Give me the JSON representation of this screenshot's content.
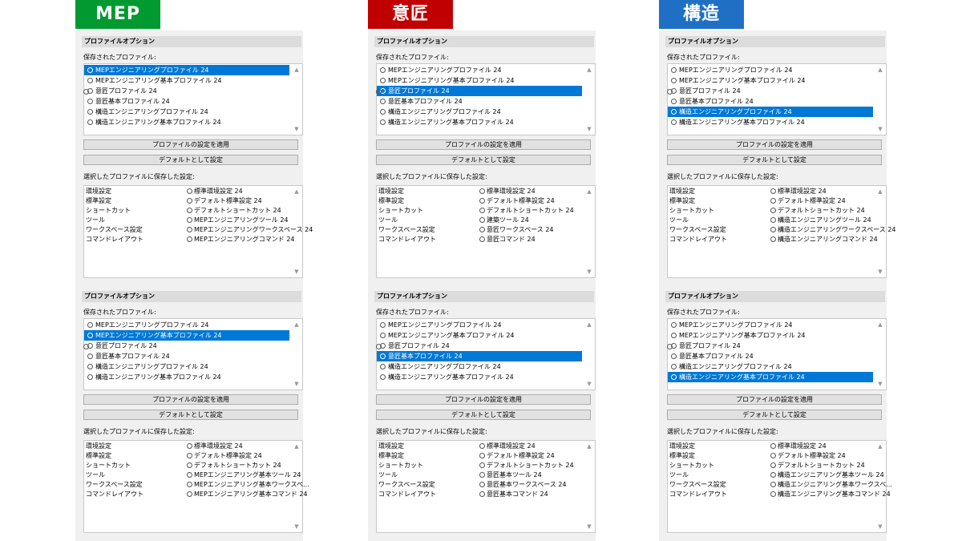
{
  "columns": [
    {
      "title": "MEP",
      "color": "#009a30",
      "panels": [
        {
          "header": "プロファイルオプション",
          "saved_label": "保存されたプロファイル:",
          "profiles": [
            {
              "name": "MEPエンジニアリングプロファイル 24",
              "selected": true,
              "icon": "profile-icon"
            },
            {
              "name": "MEPエンジニアリング基本プロファイル 24",
              "selected": false,
              "icon": "profile-icon"
            },
            {
              "name": "意匠プロファイル 24",
              "selected": false,
              "icon": "active-profile-icon"
            },
            {
              "name": "意匠基本プロファイル 24",
              "selected": false,
              "icon": "profile-icon"
            },
            {
              "name": "構造エンジニアリングプロファイル 24",
              "selected": false,
              "icon": "profile-icon"
            },
            {
              "name": "構造エンジニアリング基本プロファイル 24",
              "selected": false,
              "icon": "profile-icon"
            }
          ],
          "apply_button": "プロファイルの設定を適用",
          "default_button": "デフォルトとして設定",
          "settings_label": "選択したプロファイルに保存した設定:",
          "settings": [
            {
              "name": "環境設定",
              "value": "標準環境設定 24"
            },
            {
              "name": "標準設定",
              "value": "デフォルト標準設定 24"
            },
            {
              "name": "ショートカット",
              "value": "デフォルトショートカット 24"
            },
            {
              "name": "ツール",
              "value": "MEPエンジニアリングツール 24"
            },
            {
              "name": "ワークスペース設定",
              "value": "MEPエンジニアリングワークスペース 24"
            },
            {
              "name": "コマンドレイアウト",
              "value": "MEPエンジニアリングコマンド 24"
            }
          ]
        },
        {
          "header": "プロファイルオプション",
          "saved_label": "保存されたプロファイル:",
          "profiles": [
            {
              "name": "MEPエンジニアリングプロファイル 24",
              "selected": false,
              "icon": "profile-icon"
            },
            {
              "name": "MEPエンジニアリング基本プロファイル 24",
              "selected": true,
              "icon": "profile-icon"
            },
            {
              "name": "意匠プロファイル 24",
              "selected": false,
              "icon": "active-profile-icon"
            },
            {
              "name": "意匠基本プロファイル 24",
              "selected": false,
              "icon": "profile-icon"
            },
            {
              "name": "構造エンジニアリングプロファイル 24",
              "selected": false,
              "icon": "profile-icon"
            },
            {
              "name": "構造エンジニアリング基本プロファイル 24",
              "selected": false,
              "icon": "profile-icon"
            }
          ],
          "apply_button": "プロファイルの設定を適用",
          "default_button": "デフォルトとして設定",
          "settings_label": "選択したプロファイルに保存した設定:",
          "settings": [
            {
              "name": "環境設定",
              "value": "標準環境設定 24"
            },
            {
              "name": "標準設定",
              "value": "デフォルト標準設定 24"
            },
            {
              "name": "ショートカット",
              "value": "デフォルトショートカット 24"
            },
            {
              "name": "ツール",
              "value": "MEPエンジニアリング基本ツール 24"
            },
            {
              "name": "ワークスペース設定",
              "value": "MEPエンジニアリング基本ワークスペ..."
            },
            {
              "name": "コマンドレイアウト",
              "value": "MEPエンジニアリング基本コマンド 24"
            }
          ]
        }
      ]
    },
    {
      "title": "意匠",
      "color": "#c00000",
      "panels": [
        {
          "header": "プロファイルオプション",
          "saved_label": "保存されたプロファイル:",
          "profiles": [
            {
              "name": "MEPエンジニアリングプロファイル 24",
              "selected": false,
              "icon": "profile-icon"
            },
            {
              "name": "MEPエンジニアリング基本プロファイル 24",
              "selected": false,
              "icon": "profile-icon"
            },
            {
              "name": "意匠プロファイル 24",
              "selected": true,
              "icon": "active-profile-icon"
            },
            {
              "name": "意匠基本プロファイル 24",
              "selected": false,
              "icon": "profile-icon"
            },
            {
              "name": "構造エンジニアリングプロファイル 24",
              "selected": false,
              "icon": "profile-icon"
            },
            {
              "name": "構造エンジニアリング基本プロファイル 24",
              "selected": false,
              "icon": "profile-icon"
            }
          ],
          "apply_button": "プロファイルの設定を適用",
          "default_button": "デフォルトとして設定",
          "settings_label": "選択したプロファイルに保存した設定:",
          "settings": [
            {
              "name": "環境設定",
              "value": "標準環境設定 24"
            },
            {
              "name": "標準設定",
              "value": "デフォルト標準設定 24"
            },
            {
              "name": "ショートカット",
              "value": "デフォルトショートカット 24"
            },
            {
              "name": "ツール",
              "value": "建築ツール 24"
            },
            {
              "name": "ワークスペース設定",
              "value": "意匠ワークスペース 24"
            },
            {
              "name": "コマンドレイアウト",
              "value": "意匠コマンド 24"
            }
          ]
        },
        {
          "header": "プロファイルオプション",
          "saved_label": "保存されたプロファイル:",
          "profiles": [
            {
              "name": "MEPエンジニアリングプロファイル 24",
              "selected": false,
              "icon": "profile-icon"
            },
            {
              "name": "MEPエンジニアリング基本プロファイル 24",
              "selected": false,
              "icon": "profile-icon"
            },
            {
              "name": "意匠プロファイル 24",
              "selected": false,
              "icon": "active-profile-icon"
            },
            {
              "name": "意匠基本プロファイル 24",
              "selected": true,
              "icon": "profile-icon"
            },
            {
              "name": "構造エンジニアリングプロファイル 24",
              "selected": false,
              "icon": "profile-icon"
            },
            {
              "name": "構造エンジニアリング基本プロファイル 24",
              "selected": false,
              "icon": "profile-icon"
            }
          ],
          "apply_button": "プロファイルの設定を適用",
          "default_button": "デフォルトとして設定",
          "settings_label": "選択したプロファイルに保存した設定:",
          "settings": [
            {
              "name": "環境設定",
              "value": "標準環境設定 24"
            },
            {
              "name": "標準設定",
              "value": "デフォルト標準設定 24"
            },
            {
              "name": "ショートカット",
              "value": "デフォルトショートカット 24"
            },
            {
              "name": "ツール",
              "value": "意匠基本ツール 24"
            },
            {
              "name": "ワークスペース設定",
              "value": "意匠基本ワークスペース 24"
            },
            {
              "name": "コマンドレイアウト",
              "value": "意匠基本コマンド 24"
            }
          ]
        }
      ]
    },
    {
      "title": "構造",
      "color": "#1f6fc5",
      "panels": [
        {
          "header": "プロファイルオプション",
          "saved_label": "保存されたプロファイル:",
          "profiles": [
            {
              "name": "MEPエンジニアリングプロファイル 24",
              "selected": false,
              "icon": "profile-icon"
            },
            {
              "name": "MEPエンジニアリング基本プロファイル 24",
              "selected": false,
              "icon": "profile-icon"
            },
            {
              "name": "意匠プロファイル 24",
              "selected": false,
              "icon": "active-profile-icon"
            },
            {
              "name": "意匠基本プロファイル 24",
              "selected": false,
              "icon": "profile-icon"
            },
            {
              "name": "構造エンジニアリングプロファイル 24",
              "selected": true,
              "icon": "profile-icon"
            },
            {
              "name": "構造エンジニアリング基本プロファイル 24",
              "selected": false,
              "icon": "profile-icon"
            }
          ],
          "apply_button": "プロファイルの設定を適用",
          "default_button": "デフォルトとして設定",
          "settings_label": "選択したプロファイルに保存した設定:",
          "settings": [
            {
              "name": "環境設定",
              "value": "標準環境設定 24"
            },
            {
              "name": "標準設定",
              "value": "デフォルト標準設定 24"
            },
            {
              "name": "ショートカット",
              "value": "デフォルトショートカット 24"
            },
            {
              "name": "ツール",
              "value": "構造エンジニアリングツール 24"
            },
            {
              "name": "ワークスペース設定",
              "value": "構造エンジニアリングワークスペース 24"
            },
            {
              "name": "コマンドレイアウト",
              "value": "構造エンジニアリングコマンド 24"
            }
          ]
        },
        {
          "header": "プロファイルオプション",
          "saved_label": "保存されたプロファイル:",
          "profiles": [
            {
              "name": "MEPエンジニアリングプロファイル 24",
              "selected": false,
              "icon": "profile-icon"
            },
            {
              "name": "MEPエンジニアリング基本プロファイル 24",
              "selected": false,
              "icon": "profile-icon"
            },
            {
              "name": "意匠プロファイル 24",
              "selected": false,
              "icon": "active-profile-icon"
            },
            {
              "name": "意匠基本プロファイル 24",
              "selected": false,
              "icon": "profile-icon"
            },
            {
              "name": "構造エンジニアリングプロファイル 24",
              "selected": false,
              "icon": "profile-icon"
            },
            {
              "name": "構造エンジニアリング基本プロファイル 24",
              "selected": true,
              "icon": "profile-icon"
            }
          ],
          "apply_button": "プロファイルの設定を適用",
          "default_button": "デフォルトとして設定",
          "settings_label": "選択したプロファイルに保存した設定:",
          "settings": [
            {
              "name": "環境設定",
              "value": "標準環境設定 24"
            },
            {
              "name": "標準設定",
              "value": "デフォルト標準設定 24"
            },
            {
              "name": "ショートカット",
              "value": "デフォルトショートカット 24"
            },
            {
              "name": "ツール",
              "value": "構造エンジニアリング基本ツール 24"
            },
            {
              "name": "ワークスペース設定",
              "value": "構造エンジニアリング基本ワークスペ..."
            },
            {
              "name": "コマンドレイアウト",
              "value": "構造エンジニアリング基本コマンド 24"
            }
          ]
        }
      ]
    }
  ],
  "scroll_up_glyph": "▲",
  "scroll_down_glyph": "▼",
  "selection_color": "#0078d7"
}
